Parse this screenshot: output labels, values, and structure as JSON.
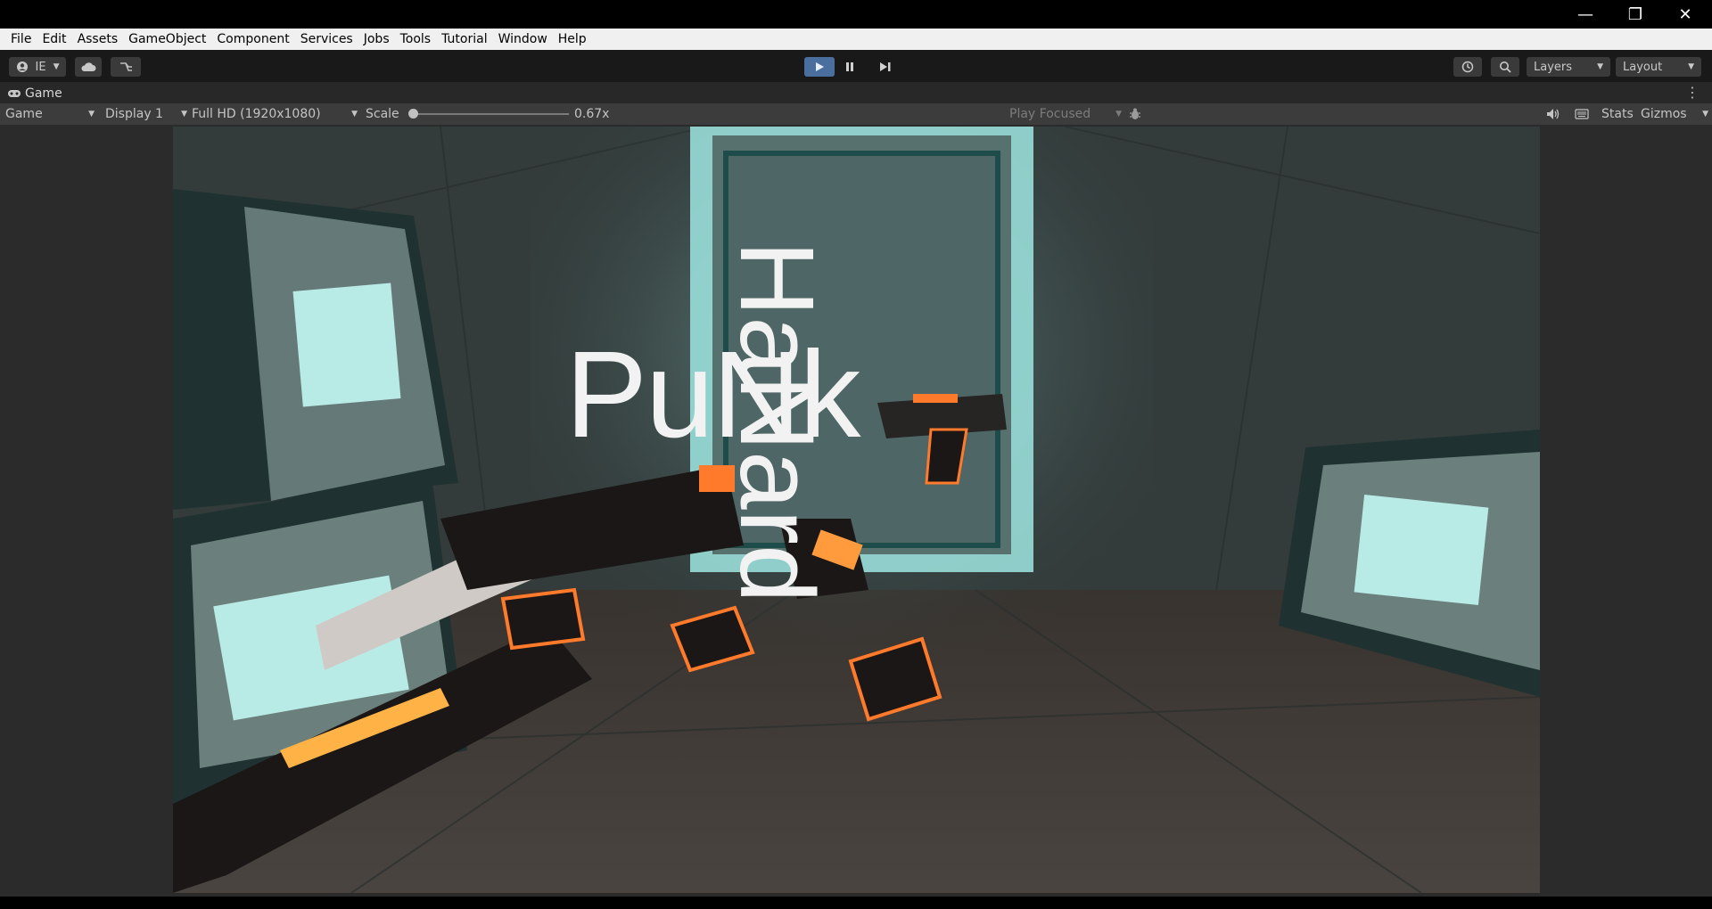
{
  "window_controls": {
    "minimize": "—",
    "restore": "❐",
    "close": "✕"
  },
  "menu": [
    "File",
    "Edit",
    "Assets",
    "GameObject",
    "Component",
    "Services",
    "Jobs",
    "Tools",
    "Tutorial",
    "Window",
    "Help"
  ],
  "toolbar": {
    "account_label": "IE",
    "account_icon": "account-icon",
    "cloud_icon": "cloud-icon",
    "collab_icon": "collab-icon",
    "play_icon": "play-icon",
    "pause_icon": "pause-icon",
    "step_icon": "step-icon",
    "history_icon": "history-icon",
    "search_icon": "search-icon",
    "layers_label": "Layers",
    "layout_label": "Layout"
  },
  "tab": {
    "label": "Game"
  },
  "gameview": {
    "mode": "Game",
    "display": "Display 1",
    "resolution": "Full HD (1920x1080)",
    "scale_label": "Scale",
    "scale_value": "0.67x",
    "scale_fraction": 0.0,
    "play_focused": "Play Focused",
    "stats_label": "Stats",
    "gizmos_label": "Gizmos"
  },
  "game_title": {
    "word1": "PuNk",
    "word2": "HaNard"
  },
  "colors": {
    "accent_play": "#4a6e9e",
    "teal_glow": "#9fe6e2",
    "orange_glow": "#ff7a2a"
  }
}
